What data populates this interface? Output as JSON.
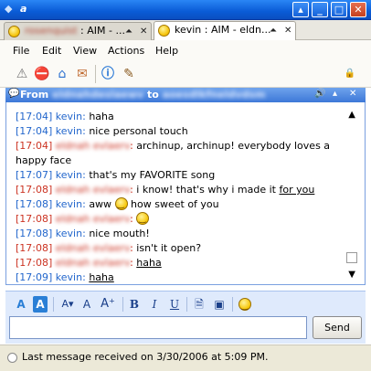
{
  "window": {
    "title": "a"
  },
  "tabs": [
    {
      "name": "rosenquist",
      "title_suffix": ": AIM - ..."
    },
    {
      "name": "kevin",
      "title_suffix": ": AIM - eldn..."
    }
  ],
  "menu": [
    "File",
    "Edit",
    "View",
    "Actions",
    "Help"
  ],
  "from_bar": {
    "prefix": "From",
    "sender": "eldnahdeslaewv",
    "to": "to",
    "recipient": "aoesdlkfneldvdsm"
  },
  "messages": [
    {
      "time": "[17:04]",
      "who": "kevin",
      "side": "me",
      "text": "haha",
      "underline": false
    },
    {
      "time": "[17:04]",
      "who": "kevin",
      "side": "me",
      "text": "nice personal touch",
      "underline": false
    },
    {
      "time": "[17:04]",
      "who": "eldnah evlaerv",
      "side": "them",
      "text": "archinup, archinup! everybody loves a happy face",
      "underline": false
    },
    {
      "time": "[17:07]",
      "who": "kevin",
      "side": "me",
      "text": "that's my FAVORITE song",
      "underline": false
    },
    {
      "time": "[17:08]",
      "who": "eldnah evlaerv",
      "side": "them",
      "text": "i know! that's why i made it ",
      "tail": "for you",
      "underline": false
    },
    {
      "time": "[17:08]",
      "who": "kevin",
      "side": "me",
      "text": "aww",
      "after_emoticon": "how sweet of you",
      "emoticon": "smile-emoticon"
    },
    {
      "time": "[17:08]",
      "who": "eldnah evlaerv",
      "side": "them",
      "text": "",
      "emoticon": "grin-emoticon"
    },
    {
      "time": "[17:08]",
      "who": "kevin",
      "side": "me",
      "text": "nice mouth!",
      "underline": false
    },
    {
      "time": "[17:08]",
      "who": "eldnah evlaerv",
      "side": "them",
      "text": "isn't it open?",
      "underline": false
    },
    {
      "time": "[17:08]",
      "who": "eldnah evlaerv",
      "side": "them",
      "text": "haha",
      "underline": true
    },
    {
      "time": "[17:09]",
      "who": "kevin",
      "side": "me",
      "text": "haha",
      "underline": true
    }
  ],
  "compose": {
    "value": "",
    "send_label": "Send"
  },
  "status": {
    "text": "Last message received on 3/30/2006 at 5:09 PM."
  },
  "colors": {
    "title_blue": "#0a5bd6",
    "me_blue": "#2266cc",
    "them_red": "#cc3322",
    "format_bg": "#dfeafc"
  },
  "icons": {
    "toolbar": [
      "warn-icon",
      "block-icon",
      "add-buddy-icon",
      "send-file-icon",
      "info-icon",
      "directory-icon",
      "privacy-icon"
    ],
    "format": [
      "text-color-icon",
      "background-color-icon",
      "smaller-font-icon",
      "normal-font-icon",
      "larger-font-icon",
      "bold-icon",
      "italic-icon",
      "underline-icon",
      "insert-link-icon",
      "insert-image-icon",
      "emoticon-icon"
    ]
  }
}
